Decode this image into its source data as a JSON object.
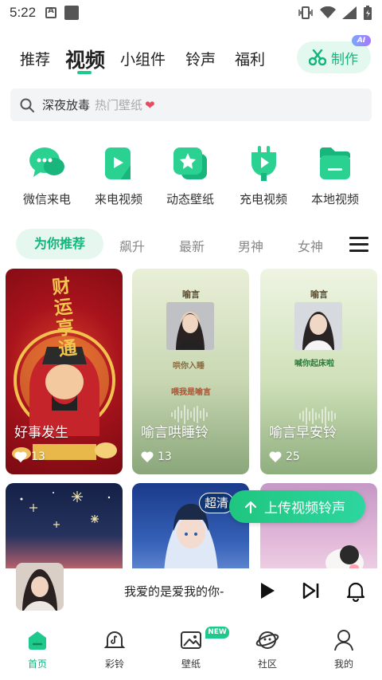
{
  "status_bar": {
    "time": "5:22"
  },
  "top_tabs": [
    {
      "label": "推荐",
      "active": false
    },
    {
      "label": "视频",
      "active": true
    },
    {
      "label": "小组件",
      "active": false
    },
    {
      "label": "铃声",
      "active": false
    },
    {
      "label": "福利",
      "active": false
    }
  ],
  "make_button": {
    "label": "制作",
    "badge": "AI"
  },
  "search": {
    "query": "深夜放毒",
    "hint": "热门壁纸",
    "heart": "❤"
  },
  "categories": [
    {
      "label": "微信来电",
      "icon": "wechat-call-icon"
    },
    {
      "label": "来电视频",
      "icon": "call-video-icon"
    },
    {
      "label": "动态壁纸",
      "icon": "live-wallpaper-icon"
    },
    {
      "label": "充电视频",
      "icon": "charging-video-icon"
    },
    {
      "label": "本地视频",
      "icon": "local-video-icon"
    }
  ],
  "sub_tabs": [
    {
      "label": "为你推荐",
      "active": true
    },
    {
      "label": "飙升",
      "active": false
    },
    {
      "label": "最新",
      "active": false
    },
    {
      "label": "男神",
      "active": false
    },
    {
      "label": "女神",
      "active": false
    }
  ],
  "cards": [
    {
      "title": "好事发生",
      "likes": "13",
      "poster_text": {
        "big": "财运亨通"
      }
    },
    {
      "title": "喻言哄睡铃",
      "likes": "13",
      "poster_text": {
        "name": "喻言",
        "line1": "哄你入睡",
        "line2": "喂我是喻言"
      }
    },
    {
      "title": "喻言早安铃",
      "likes": "25",
      "poster_text": {
        "name": "喻言",
        "line1": "喊你起床啦"
      }
    }
  ],
  "hd_badge": "超清",
  "upload_button": {
    "label": "上传视频铃声"
  },
  "player": {
    "song": "我爱的是爱我的你-"
  },
  "bottom_nav": [
    {
      "label": "首页",
      "icon": "home-icon",
      "active": true
    },
    {
      "label": "彩铃",
      "icon": "ringtone-bell-icon",
      "active": false
    },
    {
      "label": "壁纸",
      "icon": "wallpaper-icon",
      "active": false,
      "badge": "NEW"
    },
    {
      "label": "社区",
      "icon": "community-icon",
      "active": false
    },
    {
      "label": "我的",
      "icon": "profile-icon",
      "active": false
    }
  ],
  "colors": {
    "accent": "#1ec98b",
    "accent_text": "#14b57c"
  }
}
